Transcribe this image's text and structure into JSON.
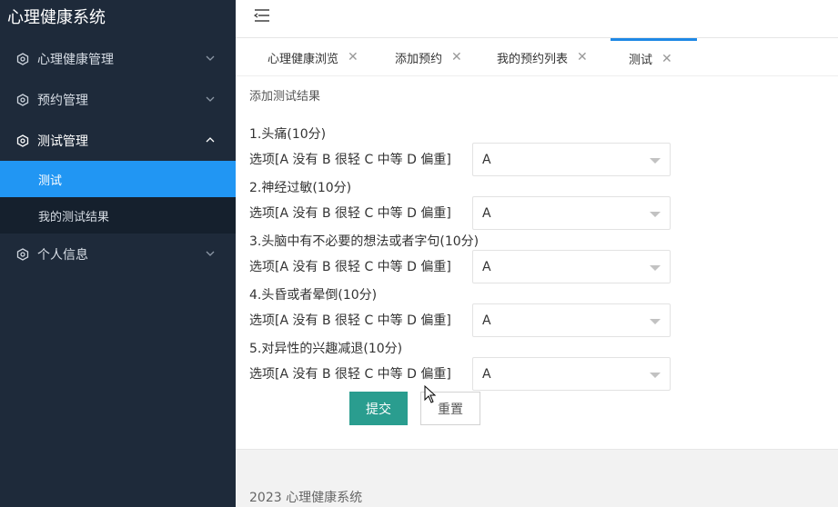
{
  "app": {
    "title": "心理健康系统"
  },
  "sidebar": {
    "items": [
      {
        "label": "心理健康管理",
        "expanded": false
      },
      {
        "label": "预约管理",
        "expanded": false
      },
      {
        "label": "测试管理",
        "expanded": true,
        "children": [
          {
            "label": "测试",
            "selected": true
          },
          {
            "label": "我的测试结果",
            "selected": false
          }
        ]
      },
      {
        "label": "个人信息",
        "expanded": false
      }
    ]
  },
  "tabs": [
    {
      "label": "心理健康浏览"
    },
    {
      "label": "添加预约"
    },
    {
      "label": "我的预约列表"
    },
    {
      "label": "测试",
      "active": true
    }
  ],
  "form": {
    "section_title": "添加测试结果",
    "option_label": "选项[A 没有 B 很轻 C 中等 D 偏重]",
    "questions": [
      {
        "title": "1.头痛(10分)",
        "value": "A"
      },
      {
        "title": "2.神经过敏(10分)",
        "value": "A"
      },
      {
        "title": "3.头脑中有不必要的想法或者字句(10分)",
        "value": "A"
      },
      {
        "title": "4.头昏或者晕倒(10分)",
        "value": "A"
      },
      {
        "title": "5.对异性的兴趣减退(10分)",
        "value": "A"
      }
    ],
    "submit_label": "提交",
    "reset_label": "重置"
  },
  "footer": {
    "text": "2023 心理健康系统"
  },
  "colors": {
    "sidebar_bg": "#1e2a3a",
    "selected_item": "#2196f3",
    "submit_button": "#2a9d8f",
    "active_tab_line": "#1e88e5"
  },
  "icons": {
    "menu_icon": "hexagon-gear-icon",
    "collapse": "chevron-icon",
    "toggle": "hamburger-icon",
    "close": "close-icon"
  }
}
